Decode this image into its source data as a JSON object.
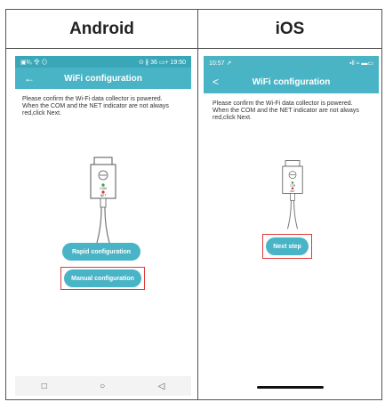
{
  "headers": {
    "android": "Android",
    "ios": "iOS"
  },
  "android": {
    "status_left": "▣ᵇ⁄ᵢᵢ 令 ⊙",
    "status_right": "⊙ ∦ 36 ▭+ 19:50",
    "title": "WiFi configuration",
    "back": "←",
    "message_line1": "Please confirm the Wi-Fi data collector is powered.",
    "message_line2": "When the COM and the NET indicator are not always red,click Next.",
    "rapid_button": "Rapid configuration",
    "manual_button": "Manual configuration",
    "nav_square": "□",
    "nav_circle": "○",
    "nav_back": "◁"
  },
  "ios": {
    "status_time": "10:57 ↗",
    "status_icons": "▪ll ≈ ▬▭",
    "title": "WiFi configuration",
    "back": "<",
    "message_line1": "Please confirm the Wi-Fi data collector is powered.",
    "message_line2": "When the COM and the NET indicator are not always red,click Next.",
    "next_button": "Next step"
  },
  "device_labels": {
    "com": "COM",
    "net": "NET"
  },
  "colors": {
    "primary": "#49b4c6",
    "highlight": "#e03b3b"
  }
}
